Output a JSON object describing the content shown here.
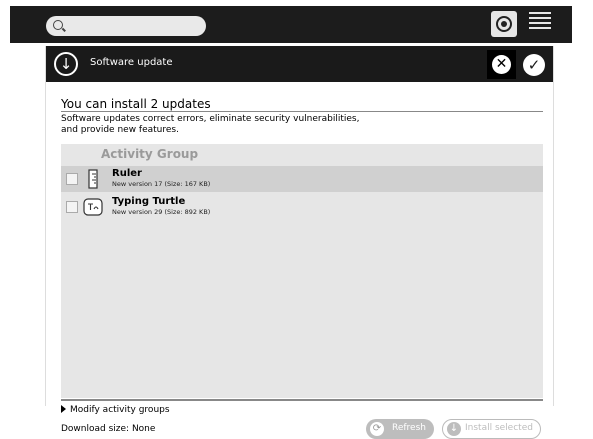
{
  "topbar": {
    "search_placeholder": "",
    "search_icon": "search-icon",
    "home_icon": "home-view-icon",
    "list_icon": "list-view-icon"
  },
  "dialog": {
    "title": "Software update",
    "icon": "software-update-icon",
    "cancel_icon": "cancel-icon",
    "ok_icon": "ok-icon",
    "headline": "You can install 2 updates",
    "description": "Software updates correct errors, eliminate security vulnerabilities, and provide new features.",
    "group_header": "Activity Group",
    "items": [
      {
        "name": "Ruler",
        "details": "New version 17 (Size: 167 KB)",
        "icon": "ruler-icon",
        "checked": false
      },
      {
        "name": "Typing Turtle",
        "details": "New version 29 (Size: 892 KB)",
        "icon": "typing-turtle-icon",
        "checked": false
      }
    ],
    "modify_groups_label": "Modify activity groups",
    "download_size_label": "Download size: None",
    "refresh_label": "Refresh",
    "install_label": "Install selected"
  },
  "colors": {
    "topbar_bg": "#1c1c1c",
    "dialog_header_bg": "#1a1a1a",
    "list_bg": "#e6e6e6",
    "selected_row_bg": "#d0d0d0",
    "disabled_button": "#bdbdbd"
  }
}
